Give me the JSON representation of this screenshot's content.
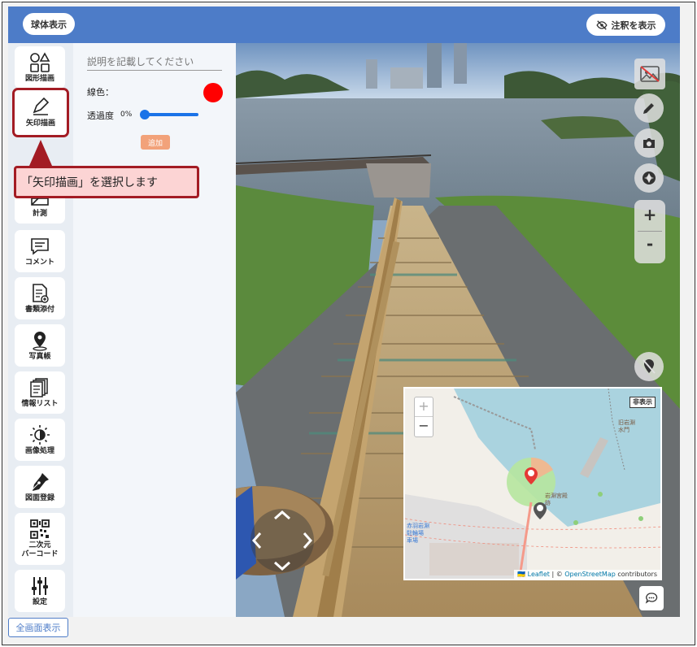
{
  "header": {
    "globe_button": "球体表示",
    "annotation_button": "注釈を表示"
  },
  "sidebar": {
    "items": [
      {
        "label": "図形描画",
        "icon": "shapes-icon"
      },
      {
        "label": "矢印描画",
        "icon": "arrow-draw-icon",
        "active": true
      },
      {
        "label": "計測",
        "icon": "measure-icon"
      },
      {
        "label": "コメント",
        "icon": "comment-icon"
      },
      {
        "label": "書類添付",
        "icon": "document-attach-icon"
      },
      {
        "label": "写真帳",
        "icon": "map-pin-icon"
      },
      {
        "label": "情報リスト",
        "icon": "info-list-icon"
      },
      {
        "label": "画像処理",
        "icon": "brightness-icon"
      },
      {
        "label": "図面登録",
        "icon": "pen-nib-icon"
      },
      {
        "label": "二次元\nバーコード",
        "icon": "qr-code-icon"
      },
      {
        "label": "設定",
        "icon": "sliders-icon"
      }
    ]
  },
  "panel": {
    "description_placeholder": "説明を記載してください",
    "line_color_label": "線色：",
    "line_color": "#ff0000",
    "opacity_label": "透過度",
    "opacity_value": "0%",
    "opacity_fraction": 0,
    "add_button": "追加"
  },
  "callout": {
    "text": "「矢印描画」を選択します"
  },
  "map": {
    "hide_button": "非表示",
    "zoom_in": "+",
    "zoom_out": "−",
    "label_gate": "旧岩淵\n水門",
    "label_site": "荒川知水\n資料館\nアモア",
    "label_station": "赤羽岩淵\n駐輪場\n車場",
    "label_site2": "岩淵宮殿\n跡",
    "attribution_prefix": "🇺🇦",
    "attribution_leaflet": "Leaflet",
    "attribution_sep": " | © ",
    "attribution_osm": "OpenStreetMap",
    "attribution_suffix": " contributors"
  },
  "viewer": {
    "zoom_in": "+",
    "zoom_out": "-"
  },
  "footer": {
    "fullscreen_button": "全画面表示"
  },
  "colors": {
    "header": "#4d7cc8",
    "active_border": "#a31c24",
    "callout_bg": "#fcd4d4",
    "add_button": "#f2a27a",
    "slider": "#1a73e8"
  }
}
